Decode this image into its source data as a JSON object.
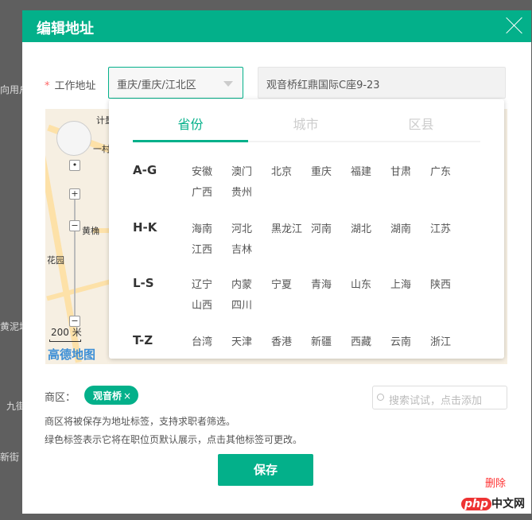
{
  "background": {
    "labels": [
      "向用户",
      "九街",
      "新街",
      "黄泥塝"
    ]
  },
  "modal": {
    "title": "编辑地址"
  },
  "form": {
    "label": "工作地址",
    "required_mark": "*",
    "region_value": "重庆/重庆/江北区",
    "address_value": "观音桥红鼎国际C座9-23"
  },
  "map": {
    "labels": [
      "计量",
      "一村",
      "黄桷",
      "花园"
    ],
    "scale": "200 米",
    "logo": "高德地图"
  },
  "dropdown": {
    "tabs": [
      "省份",
      "城市",
      "区县"
    ],
    "active_tab": 0,
    "groups": [
      {
        "name": "A-G",
        "items": [
          "安徽",
          "澳门",
          "北京",
          "重庆",
          "福建",
          "甘肃",
          "广东",
          "广西",
          "贵州"
        ]
      },
      {
        "name": "H-K",
        "items": [
          "海南",
          "河北",
          "黑龙江",
          "河南",
          "湖北",
          "湖南",
          "江苏",
          "江西",
          "吉林"
        ]
      },
      {
        "name": "L-S",
        "items": [
          "辽宁",
          "内蒙",
          "宁夏",
          "青海",
          "山东",
          "上海",
          "陕西",
          "山西",
          "四川"
        ]
      },
      {
        "name": "T-Z",
        "items": [
          "台湾",
          "天津",
          "香港",
          "新疆",
          "西藏",
          "云南",
          "浙江"
        ]
      }
    ]
  },
  "business_area": {
    "label": "商区：",
    "tag": "观音桥",
    "tag_remove": "×",
    "search_placeholder": "搜索试试，点击添加",
    "notes": [
      "商区将被保存为地址标签，支持求职者筛选。",
      "绿色标签表示它将在职位页默认展示，点击其他标签可更改。"
    ]
  },
  "actions": {
    "save": "保存",
    "delete": "删除"
  },
  "watermark": {
    "brand": "php",
    "text": "中文网"
  },
  "colors": {
    "accent": "#03b08a",
    "danger": "#ff3333"
  }
}
